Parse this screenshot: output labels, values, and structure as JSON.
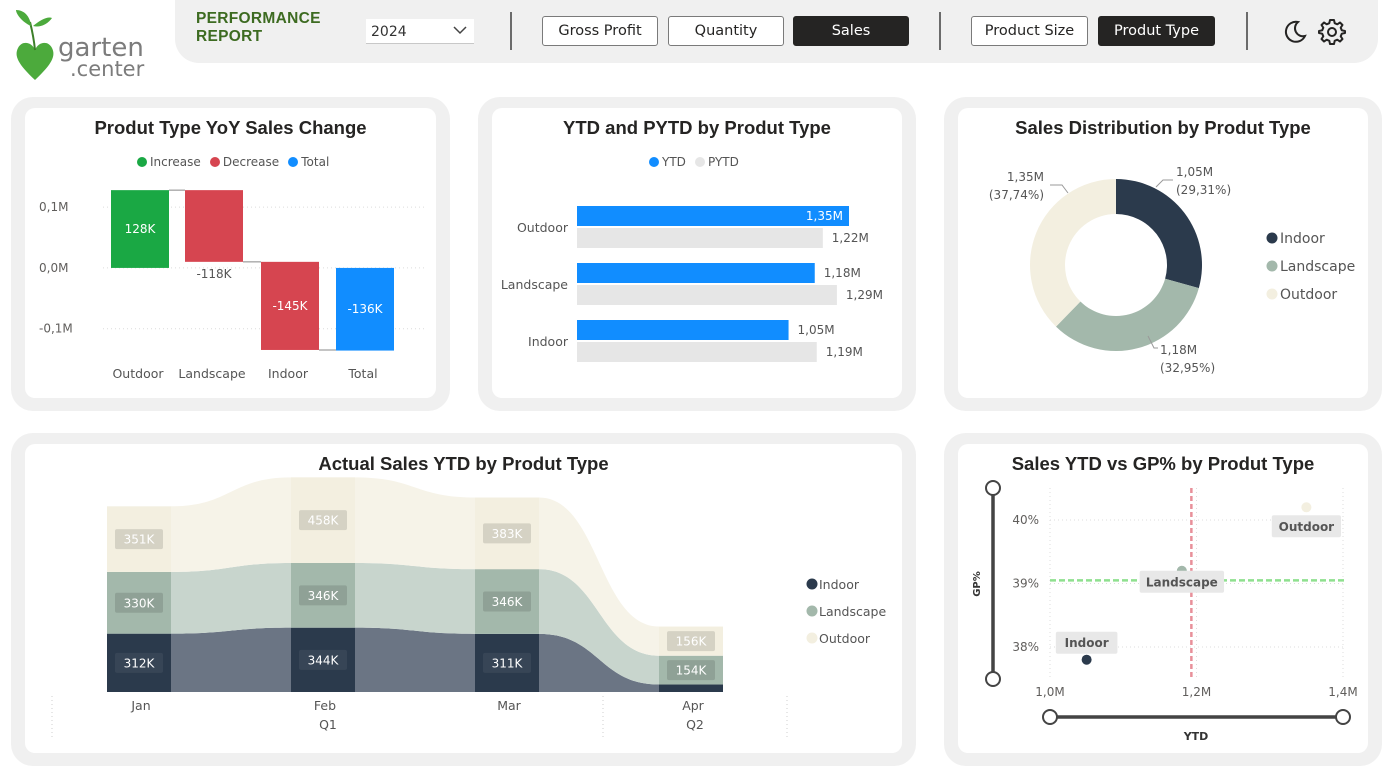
{
  "header": {
    "logo_text": "garten.center",
    "title_line1": "PERFORMANCE",
    "title_line2": "REPORT",
    "year": "2024",
    "measure_buttons": [
      {
        "label": "Gross Profit",
        "active": false
      },
      {
        "label": "Quantity",
        "active": false
      },
      {
        "label": "Sales",
        "active": true
      }
    ],
    "dimension_buttons": [
      {
        "label": "Product Size",
        "active": false
      },
      {
        "label": "Produt Type",
        "active": true
      }
    ],
    "icons": [
      "moon-icon",
      "gear-icon"
    ]
  },
  "colors": {
    "increase": "#1aa844",
    "decrease": "#d64550",
    "total": "#118dff",
    "ytd": "#118dff",
    "pytd": "#e6e6e6",
    "indoor": "#2b3a4c",
    "landscape": "#a3b8ab",
    "outdoor": "#f3efe0",
    "accent": "#3d6b21"
  },
  "chart_data": [
    {
      "id": "waterfall",
      "type": "bar",
      "title": "Produt Type YoY Sales Change",
      "legend": [
        "Increase",
        "Decrease",
        "Total"
      ],
      "categories": [
        "Outdoor",
        "Landscape",
        "Indoor",
        "Total"
      ],
      "values": [
        128,
        -118,
        -145,
        -136
      ],
      "labels": [
        "128K",
        "-118K",
        "-145K",
        "-136K"
      ],
      "kinds": [
        "increase",
        "decrease",
        "decrease",
        "total"
      ],
      "yticks": [
        0.1,
        0.0,
        -0.1
      ],
      "ytick_labels": [
        "0,1M",
        "0,0M",
        "-0,1M"
      ],
      "ylim": [
        -0.14,
        0.12
      ],
      "grid": true
    },
    {
      "id": "ytd_pytd",
      "type": "bar",
      "title": "YTD and PYTD by Produt Type",
      "categories": [
        "Outdoor",
        "Landscape",
        "Indoor"
      ],
      "series": [
        {
          "name": "YTD",
          "values": [
            1.35,
            1.18,
            1.05
          ],
          "labels": [
            "1,35M",
            "1,18M",
            "1,05M"
          ]
        },
        {
          "name": "PYTD",
          "values": [
            1.22,
            1.29,
            1.19
          ],
          "labels": [
            "1,22M",
            "1,29M",
            "1,19M"
          ]
        }
      ],
      "xlim": [
        0,
        1.5
      ]
    },
    {
      "id": "distribution",
      "type": "pie",
      "title": "Sales Distribution by Produt Type",
      "categories": [
        "Indoor",
        "Landscape",
        "Outdoor"
      ],
      "values": [
        1.05,
        1.18,
        1.35
      ],
      "labels": [
        "1,05M",
        "1,18M",
        "1,35M"
      ],
      "percents": [
        "(29,31%)",
        "(32,95%)",
        "(37,74%)"
      ],
      "legend_placement": "right"
    },
    {
      "id": "actual_sales",
      "type": "area",
      "title": "Actual Sales YTD by Produt Type",
      "categories": [
        "Jan",
        "Feb",
        "Mar",
        "Apr"
      ],
      "quarters": [
        "Q1",
        "Q2"
      ],
      "series": [
        {
          "name": "Indoor",
          "values": [
            312,
            344,
            311,
            40
          ],
          "labels": [
            "312K",
            "344K",
            "311K",
            ""
          ]
        },
        {
          "name": "Landscape",
          "values": [
            330,
            346,
            346,
            154
          ],
          "labels": [
            "330K",
            "346K",
            "346K",
            "154K"
          ]
        },
        {
          "name": "Outdoor",
          "values": [
            351,
            458,
            383,
            156
          ],
          "labels": [
            "351K",
            "458K",
            "383K",
            "156K"
          ]
        }
      ],
      "legend_placement": "right"
    },
    {
      "id": "scatter",
      "type": "scatter",
      "title": "Sales YTD vs GP% by Produt Type",
      "xlabel": "YTD",
      "ylabel": "GP%",
      "xticks": [
        "1,0M",
        "1,2M",
        "1,4M"
      ],
      "yticks": [
        "40%",
        "39%",
        "38%"
      ],
      "xlim": [
        1.0,
        1.4
      ],
      "ylim": [
        37.5,
        40.5
      ],
      "points": [
        {
          "name": "Indoor",
          "x": 1.05,
          "y": 37.8
        },
        {
          "name": "Landscape",
          "x": 1.18,
          "y": 39.2
        },
        {
          "name": "Outdoor",
          "x": 1.35,
          "y": 40.2
        }
      ],
      "avg_x": 1.193,
      "avg_y": 39.05
    }
  ]
}
